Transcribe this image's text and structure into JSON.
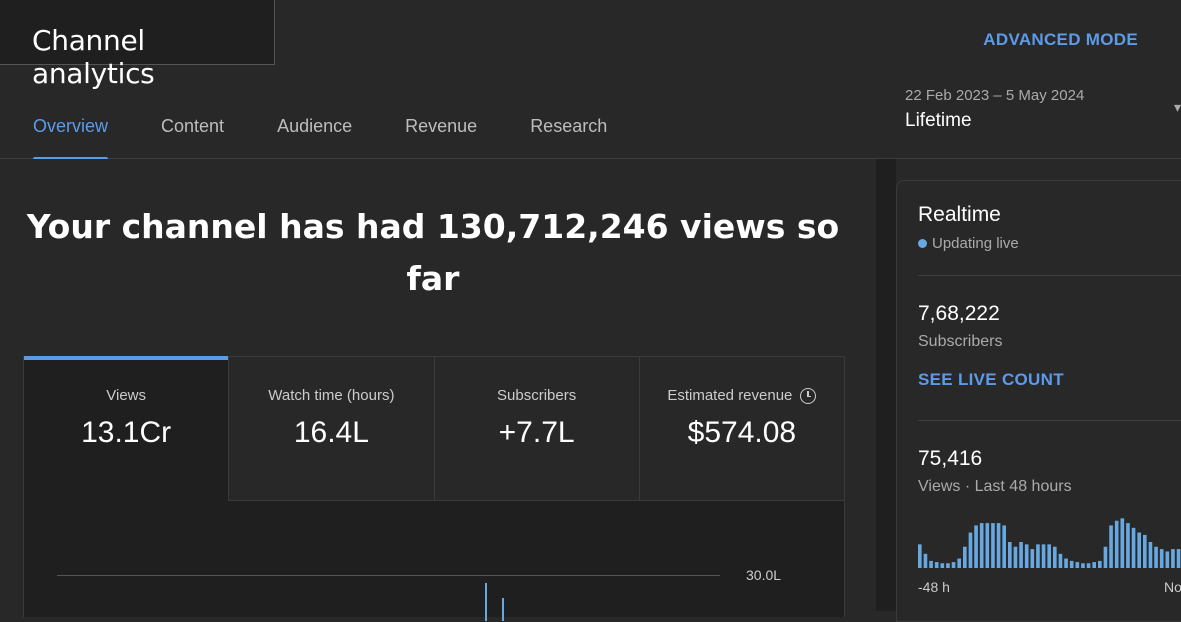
{
  "header": {
    "title": "Channel analytics",
    "advanced_mode": "ADVANCED MODE",
    "tabs": [
      {
        "label": "Overview",
        "active": true
      },
      {
        "label": "Content",
        "active": false
      },
      {
        "label": "Audience",
        "active": false
      },
      {
        "label": "Revenue",
        "active": false
      },
      {
        "label": "Research",
        "active": false
      }
    ],
    "date_range": "22 Feb 2023 – 5 May 2024",
    "date_label": "Lifetime"
  },
  "main": {
    "headline": "Your channel has had 130,712,246 views so far",
    "metrics": [
      {
        "label": "Views",
        "value": "13.1Cr",
        "active": true
      },
      {
        "label": "Watch time (hours)",
        "value": "16.4L",
        "active": false
      },
      {
        "label": "Subscribers",
        "value": "+7.7L",
        "active": false
      },
      {
        "label": "Estimated revenue",
        "value": "$574.08",
        "active": false,
        "icon": "clock-icon"
      }
    ],
    "chart": {
      "ytick": "30.0L"
    }
  },
  "realtime": {
    "title": "Realtime",
    "status": "Updating live",
    "subscribers_value": "7,68,222",
    "subscribers_label": "Subscribers",
    "see_live": "SEE LIVE COUNT",
    "views_value": "75,416",
    "views_label": "Views · Last 48 hours",
    "axis_left": "-48 h",
    "axis_right": "No",
    "bar_color": "#67a8e0"
  },
  "chart_data": {
    "type": "bar",
    "title": "",
    "xlabel": "",
    "ylabel": "",
    "values": [
      20,
      12,
      6,
      5,
      4,
      4,
      5,
      8,
      18,
      30,
      36,
      38,
      38,
      38,
      38,
      36,
      22,
      18,
      22,
      20,
      16,
      20,
      20,
      20,
      18,
      12,
      8,
      6,
      5,
      4,
      4,
      5,
      6,
      18,
      36,
      40,
      42,
      38,
      34,
      30,
      28,
      22,
      18,
      16,
      14,
      16,
      16,
      18
    ]
  },
  "colors": {
    "accent": "#5b9bea",
    "background": "#282828",
    "card": "#1f1f1f"
  }
}
